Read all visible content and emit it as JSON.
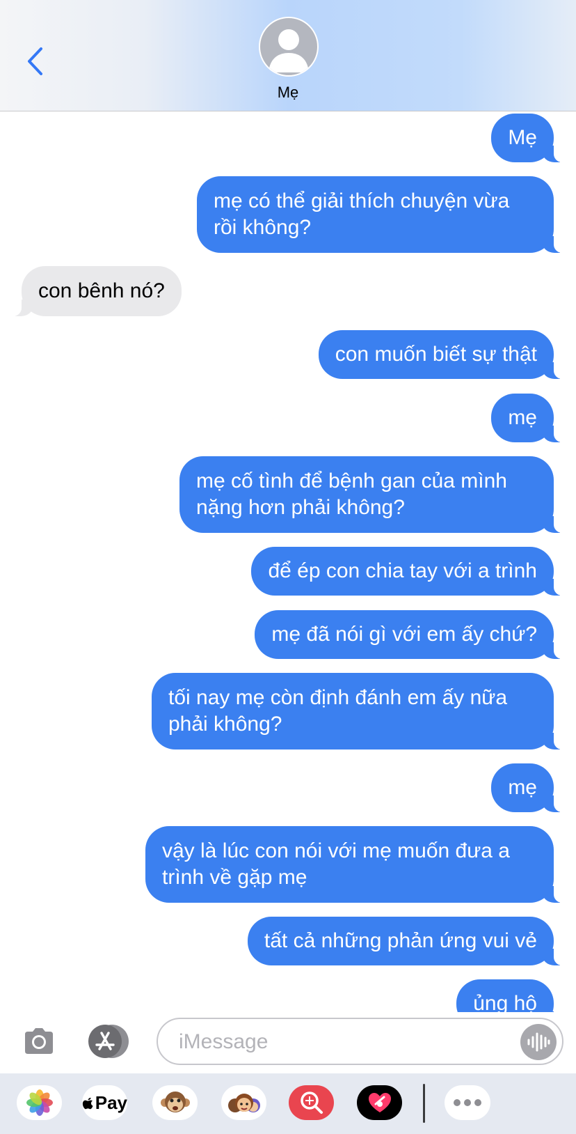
{
  "header": {
    "contact_name": "Mẹ"
  },
  "messages": [
    {
      "direction": "out",
      "text": "Mẹ"
    },
    {
      "direction": "out",
      "text": "mẹ có thể giải thích chuyện vừa rồi không?"
    },
    {
      "direction": "in",
      "text": "con bênh nó?"
    },
    {
      "direction": "out",
      "text": "con muốn biết sự thật"
    },
    {
      "direction": "out",
      "text": "mẹ"
    },
    {
      "direction": "out",
      "text": "mẹ cố tình để bệnh gan của mình nặng hơn phải không?"
    },
    {
      "direction": "out",
      "text": "để ép con chia tay với a trình"
    },
    {
      "direction": "out",
      "text": "mẹ đã nói gì với em ấy chứ?"
    },
    {
      "direction": "out",
      "text": "tối nay mẹ còn định đánh em ấy nữa phải không?"
    },
    {
      "direction": "out",
      "text": "mẹ"
    },
    {
      "direction": "out",
      "text": "vậy là lúc con nói với mẹ muốn đưa a trình về gặp mẹ"
    },
    {
      "direction": "out",
      "text": "tất cả những phản ứng vui vẻ"
    },
    {
      "direction": "out",
      "text": "ủng hộ"
    }
  ],
  "input": {
    "placeholder": "iMessage",
    "value": ""
  },
  "app_drawer": {
    "items": [
      {
        "icon": "photos-icon"
      },
      {
        "icon": "apple-pay-icon",
        "label": "Pay"
      },
      {
        "icon": "animoji-monkey-icon"
      },
      {
        "icon": "memoji-icon"
      },
      {
        "icon": "image-search-icon"
      },
      {
        "icon": "digital-touch-icon"
      },
      {
        "icon": "more-apps-icon"
      }
    ]
  },
  "colors": {
    "outgoing_bubble": "#3b80f0",
    "incoming_bubble": "#e9e9eb",
    "accent": "#3478f6"
  }
}
